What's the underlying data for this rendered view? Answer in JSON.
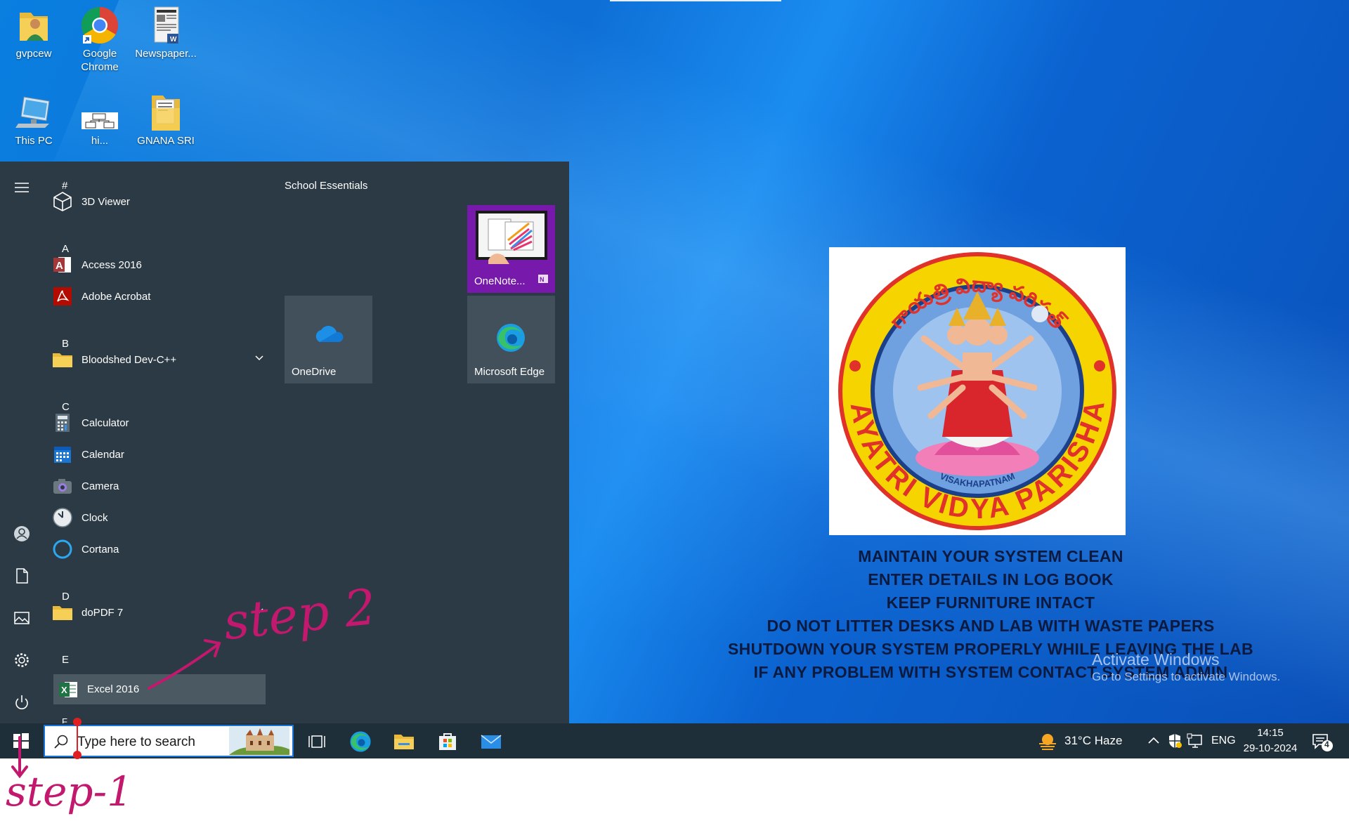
{
  "desktop": {
    "icons": [
      {
        "label": "gvpcew"
      },
      {
        "label": "Google Chrome"
      },
      {
        "label": "Newspaper..."
      },
      {
        "label": "This PC"
      },
      {
        "label": "hi..."
      },
      {
        "label": "GNANA SRI"
      }
    ],
    "logo": {
      "top_text": "గాయత్రి విద్యా పరిషత్",
      "bottom_text": "GAYATRI VIDYA PARISHAD",
      "city": "VISAKHAPATNAM"
    },
    "rules": [
      "MAINTAIN YOUR SYSTEM CLEAN",
      "ENTER DETAILS IN LOG BOOK",
      "KEEP FURNITURE INTACT",
      "DO NOT LITTER DESKS AND LAB WITH WASTE PAPERS",
      "SHUTDOWN YOUR SYSTEM PROPERLY WHILE LEAVING THE LAB",
      "IF ANY PROBLEM WITH SYSTEM CONTACT SYSTEM ADMIN"
    ],
    "activation": {
      "title": "Activate Windows",
      "subtitle": "Go to Settings to activate Windows."
    }
  },
  "start_menu": {
    "sections": [
      {
        "letter": "#",
        "apps": [
          "3D Viewer"
        ]
      },
      {
        "letter": "A",
        "apps": [
          "Access 2016",
          "Adobe Acrobat"
        ]
      },
      {
        "letter": "B",
        "apps": [
          "Bloodshed Dev-C++"
        ]
      },
      {
        "letter": "C",
        "apps": [
          "Calculator",
          "Calendar",
          "Camera",
          "Clock",
          "Cortana"
        ]
      },
      {
        "letter": "D",
        "apps": [
          "doPDF 7"
        ]
      },
      {
        "letter": "E",
        "apps": [
          "Excel 2016"
        ]
      }
    ],
    "tiles_group": "School Essentials",
    "tiles": [
      {
        "label": "OneNote..."
      },
      {
        "label": "OneDrive"
      },
      {
        "label": "Microsoft Edge"
      }
    ]
  },
  "taskbar": {
    "search_placeholder": "Type here to search",
    "weather": "31°C  Haze",
    "language": "ENG",
    "time": "14:15",
    "date": "29-10-2024",
    "notification_count": "4"
  },
  "annotations": {
    "step1": "step-1",
    "step2": "step 2"
  },
  "colors": {
    "start_bg": "#2b3a45",
    "taskbar_bg": "#1f2f3a",
    "annotation": "#c2186e",
    "logo_yellow": "#f5d400",
    "logo_red": "#e0312b"
  }
}
